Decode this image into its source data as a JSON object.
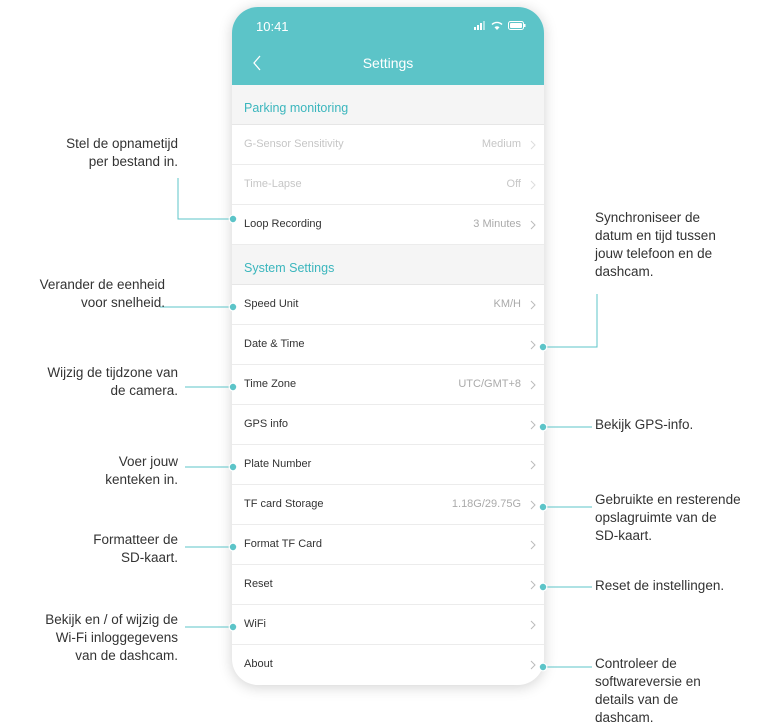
{
  "status_bar": {
    "time": "10:41"
  },
  "nav": {
    "title": "Settings"
  },
  "sections": {
    "parking": "Parking monitoring",
    "system": "System Settings"
  },
  "rows": {
    "gsensor": {
      "label": "G-Sensor Sensitivity",
      "value": "Medium"
    },
    "timelapse": {
      "label": "Time-Lapse",
      "value": "Off"
    },
    "loop": {
      "label": "Loop Recording",
      "value": "3 Minutes"
    },
    "speed": {
      "label": "Speed Unit",
      "value": "KM/H"
    },
    "datetime": {
      "label": "Date & Time"
    },
    "timezone": {
      "label": "Time Zone",
      "value": "UTC/GMT+8"
    },
    "gps": {
      "label": "GPS info"
    },
    "plate": {
      "label": "Plate Number"
    },
    "storage": {
      "label": "TF card Storage",
      "value": "1.18G/29.75G"
    },
    "format": {
      "label": "Format TF Card"
    },
    "reset": {
      "label": "Reset"
    },
    "wifi": {
      "label": "WiFi"
    },
    "about": {
      "label": "About"
    }
  },
  "annotations": {
    "loop": [
      "Stel de opnametijd",
      "per bestand in."
    ],
    "speed": [
      "Verander de eenheid",
      "voor snelheid."
    ],
    "timezone": [
      "Wijzig de tijdzone van",
      "de camera."
    ],
    "plate": [
      "Voer jouw",
      "kenteken in."
    ],
    "format": [
      "Formatteer de",
      "SD-kaart."
    ],
    "wifi": [
      "Bekijk en / of wijzig de",
      "Wi-Fi inloggegevens",
      "van de dashcam."
    ],
    "datetime": [
      "Synchroniseer de",
      "datum en tijd tussen",
      "jouw telefoon en de",
      "dashcam."
    ],
    "gps": [
      "Bekijk GPS-info."
    ],
    "storage": [
      "Gebruikte en resterende",
      "opslagruimte van de",
      "SD-kaart."
    ],
    "reset": [
      "Reset de instellingen."
    ],
    "about": [
      "Controleer de",
      "softwareversie en",
      "details van de",
      "dashcam."
    ]
  },
  "colors": {
    "accent": "#5cc4c8",
    "section_text": "#3bb6bd",
    "line": "#5cc4c8"
  },
  "icons": [
    "back-chevron-icon",
    "signal-icon",
    "wifi-icon",
    "battery-icon",
    "chevron-right-icon"
  ]
}
